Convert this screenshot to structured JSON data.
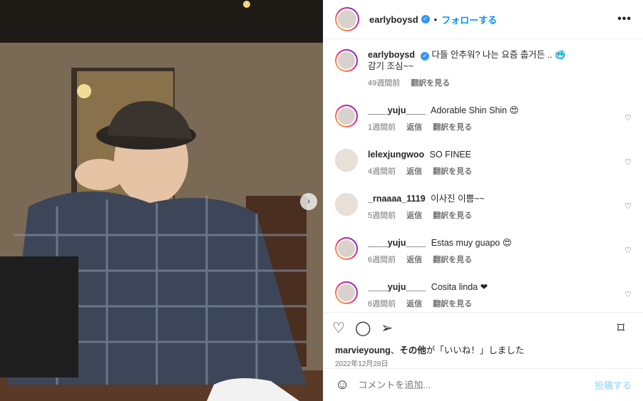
{
  "post": {
    "author": "earlyboysd",
    "follow_label": "フォローする",
    "more_label": "•••",
    "caption_line1": "다들 안추워? 나는 요즘 춥거든 .. 🥶",
    "caption_line2": "감기 조심~~",
    "caption_time": "49週間前",
    "caption_translate": "翻訳を見る"
  },
  "comments": [
    {
      "user": "____yuju____",
      "text": "Adorable Shin Shin 😍",
      "time": "1週間前",
      "reply": "返信",
      "translate": "翻訳を見る"
    },
    {
      "user": "lelexjungwoo",
      "text": "SO FINEE",
      "time": "4週間前",
      "reply": "返信",
      "translate": "翻訳を見る"
    },
    {
      "user": "_rnaaaa_1119",
      "text": "이사진 이쁨~~",
      "time": "5週間前",
      "reply": "返信",
      "translate": "翻訳を見る"
    },
    {
      "user": "____yuju____",
      "text": "Estas muy guapo 😍",
      "time": "6週間前",
      "reply": "返信",
      "translate": "翻訳を見る"
    },
    {
      "user": "____yuju____",
      "text": "Cosita linda ❤",
      "time": "6週間前",
      "reply": "返信",
      "translate": "翻訳を見る"
    }
  ],
  "likes": {
    "user": "marvieyoung",
    "sep": "、",
    "others": "その他",
    "suffix": "が「いいね！」しました"
  },
  "date": "2022年12月28日",
  "composer": {
    "placeholder": "コメントを追加...",
    "post_label": "投稿する"
  },
  "icons": {
    "like": "heart-icon",
    "comment": "comment-icon",
    "share": "share-icon",
    "save": "bookmark-icon",
    "emoji": "emoji-icon"
  }
}
